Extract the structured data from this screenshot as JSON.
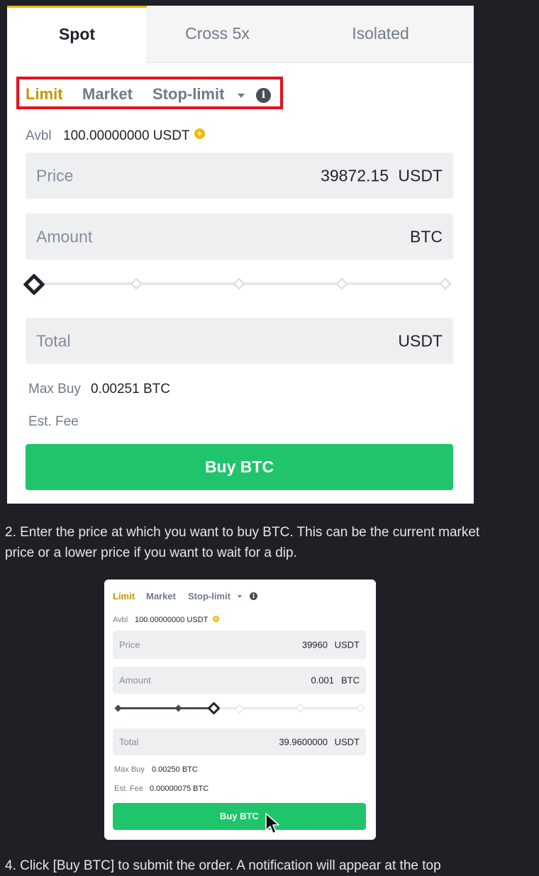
{
  "panel1": {
    "tabs": [
      "Spot",
      "Cross 5x",
      "Isolated"
    ],
    "active_tab": "Spot",
    "order_types": [
      "Limit",
      "Market",
      "Stop-limit"
    ],
    "active_order_type": "Limit",
    "avbl_label": "Avbl",
    "avbl_value": "100.00000000 USDT",
    "price_label": "Price",
    "price_value": "39872.15",
    "price_unit": "USDT",
    "amount_label": "Amount",
    "amount_unit": "BTC",
    "slider_percent": 0,
    "total_label": "Total",
    "total_unit": "USDT",
    "max_buy_label": "Max Buy",
    "max_buy_value": "0.00251 BTC",
    "est_fee_label": "Est. Fee",
    "buy_button": "Buy BTC"
  },
  "caption_step2": "2. Enter the price at which you want to buy BTC. This can be the current market price or a lower price if you want to wait for a dip.",
  "panel2": {
    "order_types": [
      "Limit",
      "Market",
      "Stop-limit"
    ],
    "active_order_type": "Limit",
    "avbl_label": "Avbl",
    "avbl_value": "100.00000000 USDT",
    "price_label": "Price",
    "price_value": "39960",
    "price_unit": "USDT",
    "amount_label": "Amount",
    "amount_value": "0.001",
    "amount_unit": "BTC",
    "slider_percent": 40,
    "total_label": "Total",
    "total_value": "39.9600000",
    "total_unit": "USDT",
    "max_buy_label": "Max Buy",
    "max_buy_value": "0.00250 BTC",
    "est_fee_label": "Est. Fee",
    "est_fee_value": "0.00000075 BTC",
    "buy_button": "Buy BTC"
  },
  "caption_step4": "4. Click [Buy BTC] to submit the order. A notification will appear at the top",
  "colors": {
    "background": "#1f2025",
    "accent_yellow": "#f0b90b",
    "limit_active": "#c99400",
    "buy_green": "#20c56b",
    "highlight_red": "#e8101c"
  },
  "icons": [
    "info-icon",
    "plus-circle-icon",
    "caret-down-icon",
    "mouse-cursor-icon"
  ]
}
